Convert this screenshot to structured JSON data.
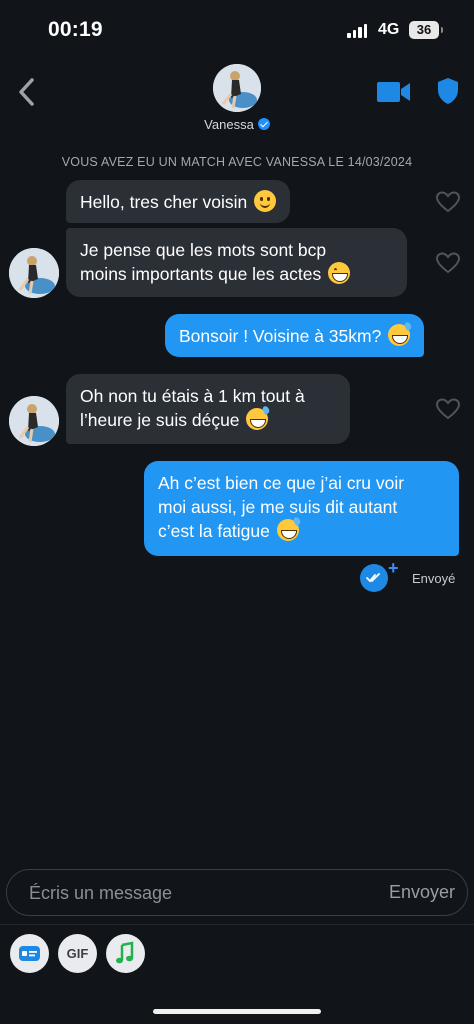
{
  "status_bar": {
    "time": "00:19",
    "network": "4G",
    "battery": "36"
  },
  "header": {
    "match_name": "Vanessa"
  },
  "match_banner": "VOUS AVEZ EU UN MATCH AVEC VANESSA LE 14/03/2024",
  "messages": [
    {
      "from": "them",
      "text": "Hello, tres cher voisin",
      "emoji": "slightly-smiling-face"
    },
    {
      "from": "them",
      "line1": "Je pense que les mots sont bcp",
      "line2": "moins importants que les actes",
      "emoji": "grinning-face"
    },
    {
      "from": "me",
      "text": "Bonsoir ! Voisine à 35km?",
      "emoji": "grinning-sweat-face"
    },
    {
      "from": "them",
      "line1": "Oh non tu étais à 1 km tout à",
      "line2": "l’heure je suis déçue",
      "emoji": "grinning-sweat-face"
    },
    {
      "from": "me",
      "line1": "Ah c’est bien ce que j’ai cru voir",
      "line2": "moi aussi, je me suis dit autant",
      "line3": "c’est la fatigue",
      "emoji": "grinning-sweat-face"
    }
  ],
  "sent_status": "Envoyé",
  "composer": {
    "placeholder": "Écris un message",
    "send_label": "Envoyer"
  },
  "toolbar": {
    "gif_label": "GIF"
  },
  "colors": {
    "background": "#111418",
    "incoming_bubble": "#2b2f36",
    "outgoing_bubble": "#2196f3",
    "accent": "#1e88e5"
  }
}
